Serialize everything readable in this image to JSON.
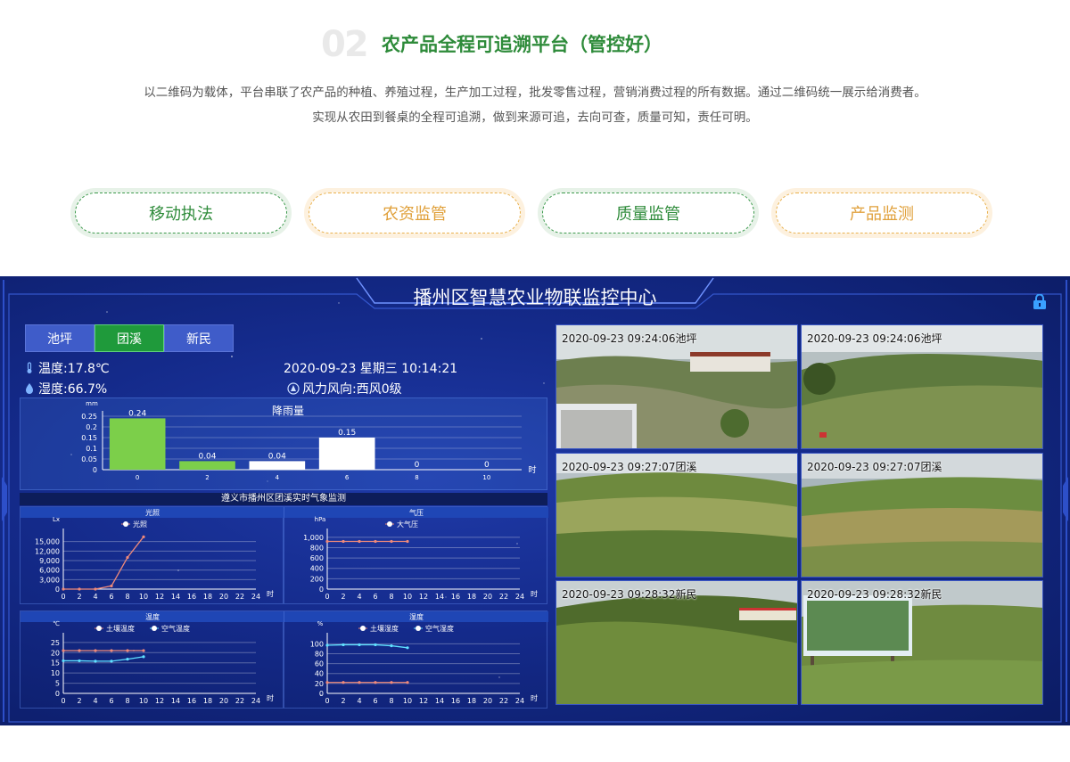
{
  "header": {
    "index_watermark": "02",
    "title": "农产品全程可追溯平台（管控好）",
    "intro_line1": "以二维码为载体，平台串联了农产品的种植、养殖过程，生产加工过程，批发零售过程，营销消费过程的所有数据。通过二维码统一展示给消费者。",
    "intro_line2": "实现从农田到餐桌的全程可追溯，做到来源可追，去向可查，质量可知，责任可明。"
  },
  "features": [
    {
      "label": "移动执法",
      "style": "green"
    },
    {
      "label": "农资监管",
      "style": "orange"
    },
    {
      "label": "质量监管",
      "style": "green"
    },
    {
      "label": "产品监测",
      "style": "orange"
    }
  ],
  "dashboard": {
    "title": "播州区智慧农业物联监控中心",
    "tabs": [
      "池坪",
      "团溪",
      "新民"
    ],
    "active_tab": 1,
    "temperature": "温度:17.8℃",
    "humidity": "湿度:66.7%",
    "datetime": "2020-09-23 星期三 10:14:21",
    "wind": "风力风向:西风0级",
    "monitor_heading": "遵义市播州区团溪实时气象监测",
    "colors": {
      "accent_green": "#1f9a3b",
      "bar_green": "#7ccf4a",
      "line_salmon": "#f08a7a",
      "line_cyan": "#5fe0ff"
    },
    "cameras": [
      {
        "label": "2020-09-23 09:24:06池坪"
      },
      {
        "label": "2020-09-23 09:24:06池坪"
      },
      {
        "label": "2020-09-23 09:27:07团溪"
      },
      {
        "label": "2020-09-23 09:27:07团溪"
      },
      {
        "label": "2020-09-23 09:28:32新民"
      },
      {
        "label": "2020-09-23 09:28:32新民"
      }
    ]
  },
  "chart_data": [
    {
      "type": "bar",
      "title": "降雨量",
      "ylabel": "mm",
      "xlabel": "时",
      "categories": [
        "0",
        "2",
        "4",
        "6",
        "8",
        "10"
      ],
      "values": [
        0.24,
        0.04,
        0.04,
        0.15,
        0,
        0
      ],
      "bar_colors": [
        "#7ccf4a",
        "#7ccf4a",
        "#ffffff",
        "#ffffff",
        "#ffffff",
        "#ffffff"
      ],
      "yticks": [
        "0",
        "0.05",
        "0.1",
        "0.15",
        "0.2",
        "0.25"
      ],
      "ylim": [
        0,
        0.25
      ]
    },
    {
      "type": "line",
      "title": "光照",
      "ylabel": "Lx",
      "xlabel": "时",
      "x": [
        0,
        2,
        4,
        6,
        8,
        10
      ],
      "xticks": [
        "0",
        "2",
        "4",
        "6",
        "8",
        "10",
        "12",
        "14",
        "16",
        "18",
        "20",
        "22",
        "24"
      ],
      "yticks": [
        "0",
        "3,000",
        "6,000",
        "9,000",
        "12,000",
        "15,000"
      ],
      "ylim": [
        0,
        18000
      ],
      "series": [
        {
          "name": "光照",
          "color": "#f08a7a",
          "values": [
            0,
            0,
            0,
            1000,
            10000,
            16500
          ]
        }
      ]
    },
    {
      "type": "line",
      "title": "气压",
      "ylabel": "hPa",
      "xlabel": "时",
      "x": [
        0,
        2,
        4,
        6,
        8,
        10
      ],
      "xticks": [
        "0",
        "2",
        "4",
        "6",
        "8",
        "10",
        "12",
        "14",
        "16",
        "18",
        "20",
        "22",
        "24"
      ],
      "yticks": [
        "0",
        "200",
        "400",
        "600",
        "800",
        "1,000"
      ],
      "ylim": [
        0,
        1100
      ],
      "series": [
        {
          "name": "大气压",
          "color": "#f08a7a",
          "values": [
            920,
            920,
            920,
            920,
            920,
            920
          ]
        }
      ]
    },
    {
      "type": "line",
      "title": "温度",
      "ylabel": "℃",
      "xlabel": "时",
      "x": [
        0,
        2,
        4,
        6,
        8,
        10
      ],
      "xticks": [
        "0",
        "2",
        "4",
        "6",
        "8",
        "10",
        "12",
        "14",
        "16",
        "18",
        "20",
        "22",
        "24"
      ],
      "yticks": [
        "0",
        "5",
        "10",
        "15",
        "20",
        "25"
      ],
      "ylim": [
        0,
        28
      ],
      "series": [
        {
          "name": "土壤温度",
          "color": "#f08a7a",
          "values": [
            21,
            21,
            21,
            21,
            21,
            21
          ]
        },
        {
          "name": "空气温度",
          "color": "#5fe0ff",
          "values": [
            16,
            16,
            15.8,
            15.8,
            16.8,
            18
          ]
        }
      ]
    },
    {
      "type": "line",
      "title": "湿度",
      "ylabel": "%",
      "xlabel": "时",
      "x": [
        0,
        2,
        4,
        6,
        8,
        10
      ],
      "xticks": [
        "0",
        "2",
        "4",
        "6",
        "8",
        "10",
        "12",
        "14",
        "16",
        "18",
        "20",
        "22",
        "24"
      ],
      "yticks": [
        "0",
        "20",
        "40",
        "60",
        "80",
        "100"
      ],
      "ylim": [
        0,
        115
      ],
      "series": [
        {
          "name": "土壤湿度",
          "color": "#f08a7a",
          "values": [
            22,
            22,
            22,
            22,
            22,
            22
          ]
        },
        {
          "name": "空气湿度",
          "color": "#5fe0ff",
          "values": [
            97,
            98,
            98,
            98,
            96,
            92
          ]
        }
      ]
    }
  ]
}
